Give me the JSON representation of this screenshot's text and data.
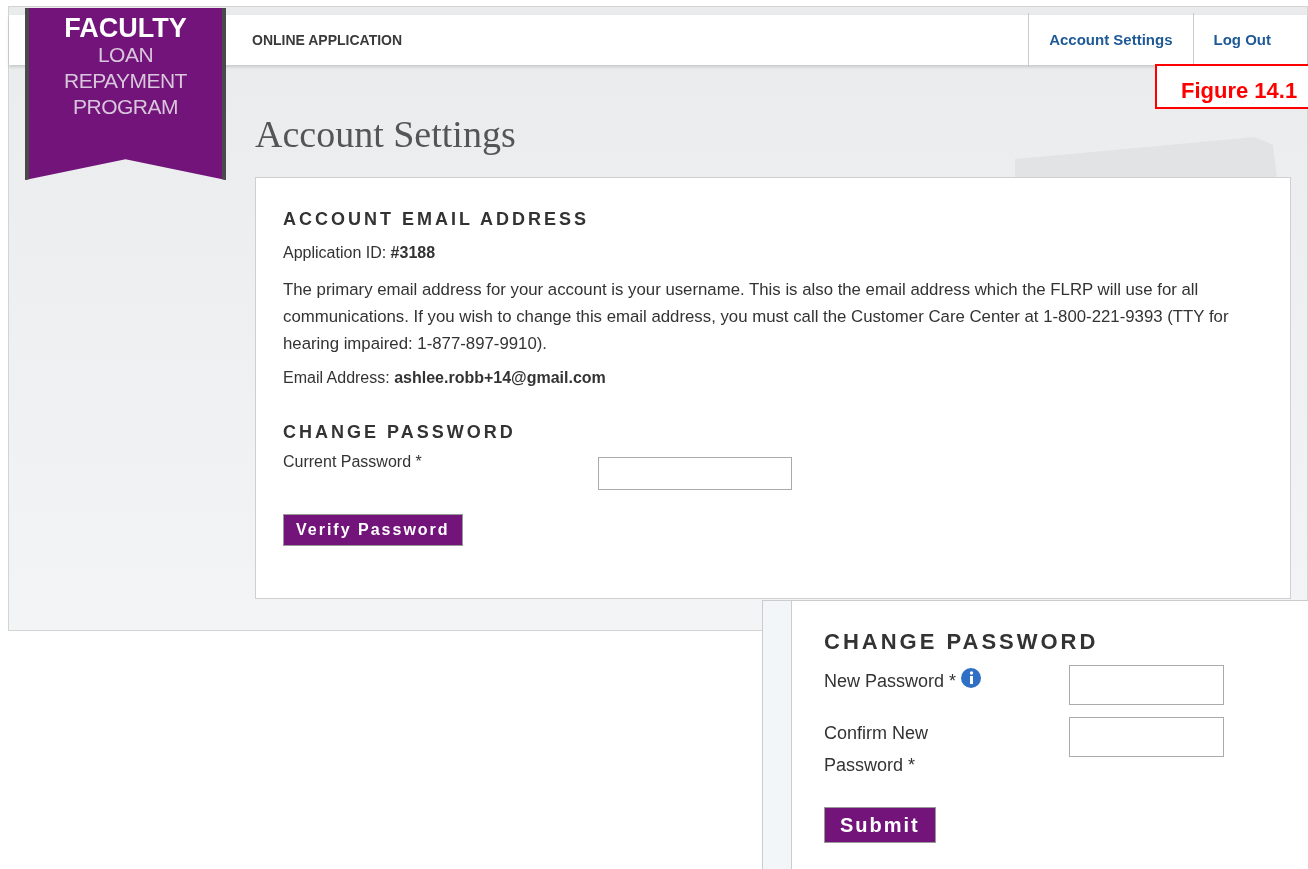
{
  "logo": {
    "lines": [
      "FACULTY",
      "LOAN",
      "REPAYMENT",
      "PROGRAM"
    ]
  },
  "header": {
    "title": "ONLINE APPLICATION",
    "links": [
      "Account Settings",
      "Log Out"
    ]
  },
  "figure_label": "Figure 14.1",
  "page_title": "Account Settings",
  "email_section": {
    "heading": "ACCOUNT EMAIL ADDRESS",
    "application_id": "Application ID: **#3188**",
    "description": "The primary email address for your account is your username. This is also the email address which the FLRP will use for all communications. If you wish to change this email address, you must call the Customer Care Center at 1-800-221-9393 (TTY for hearing impaired: 1-877-897-9910).",
    "email": "Email Address: **ashlee.robb+14@gmail.com**"
  },
  "password_section": {
    "heading": "CHANGE PASSWORD",
    "field_label": "Current Password *",
    "button": "Verify Password"
  },
  "inset": {
    "heading": "CHANGE PASSWORD",
    "fields": [
      {
        "label": "New Password *",
        "info": true
      },
      {
        "label": "Confirm New Password *",
        "info": false
      }
    ],
    "button": "Submit"
  }
}
